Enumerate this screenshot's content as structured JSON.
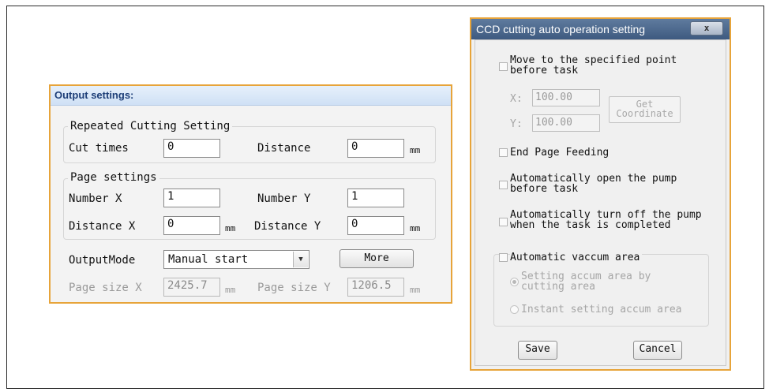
{
  "output_panel": {
    "title": "Output settings:",
    "repeated_group": {
      "label": "Repeated Cutting Setting",
      "cut_times_label": "Cut times",
      "cut_times_value": "0",
      "distance_label": "Distance",
      "distance_value": "0",
      "unit": "mm"
    },
    "page_group": {
      "label": "Page settings",
      "number_x_label": "Number X",
      "number_x_value": "1",
      "number_y_label": "Number Y",
      "number_y_value": "1",
      "distance_x_label": "Distance X",
      "distance_x_value": "0",
      "distance_y_label": "Distance Y",
      "distance_y_value": "0",
      "unit": "mm"
    },
    "output_mode_label": "OutputMode",
    "output_mode_value": "Manual start",
    "more_button": "More",
    "page_size_x_label": "Page size X",
    "page_size_x_value": "2425.7",
    "page_size_y_label": "Page size Y",
    "page_size_y_value": "1206.5",
    "unit": "mm"
  },
  "ccd_dialog": {
    "title": "CCD cutting auto operation setting",
    "close_glyph": "x",
    "move_point_line1": "Move to the specified point",
    "move_point_line2": "before task",
    "x_label": "X:",
    "x_value": "100.00",
    "y_label": "Y:",
    "y_value": "100.00",
    "get_coord_line1": "Get",
    "get_coord_line2": "Coordinate",
    "end_page_feeding": "End Page Feeding",
    "open_pump_line1": "Automatically open the pump",
    "open_pump_line2": "before task",
    "off_pump_line1": "Automatically turn off the pump",
    "off_pump_line2": "when the task is completed",
    "auto_vacuum": "Automatic vaccum area",
    "radio1_line1": "Setting accum area by",
    "radio1_line2": "cutting area",
    "radio2": "Instant setting accum area",
    "save_button": "Save",
    "cancel_button": "Cancel"
  },
  "colors": {
    "highlight_border": "#e7a43a",
    "title_bar": "#3e5a80",
    "panel_header": "#cfe0f5"
  }
}
